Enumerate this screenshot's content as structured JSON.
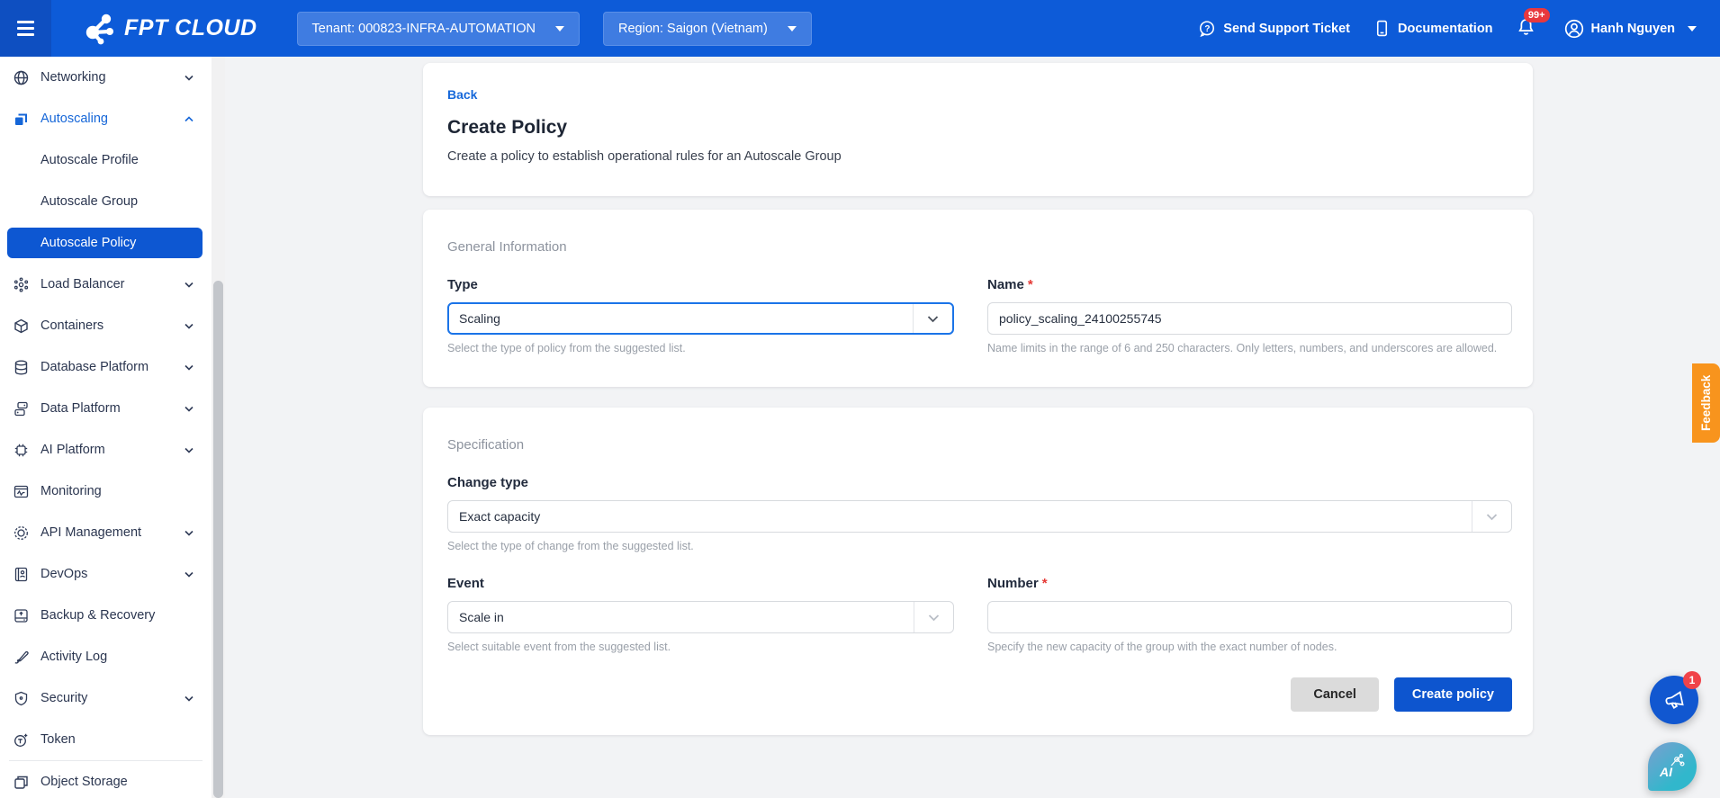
{
  "navbar": {
    "logo_text": "FPT CLOUD",
    "tenant": "Tenant: 000823-INFRA-AUTOMATION",
    "region": "Region: Saigon (Vietnam)",
    "support": "Send Support Ticket",
    "documentation": "Documentation",
    "notification_count": "99+",
    "user_name": "Hanh Nguyen"
  },
  "icons": {
    "question_glyph": "?",
    "ai_glyph": "AI"
  },
  "sidebar": {
    "items": [
      {
        "label": "Networking",
        "chevron": "down"
      },
      {
        "label": "Autoscaling",
        "chevron": "up"
      },
      {
        "label": "Load Balancer",
        "chevron": "down"
      },
      {
        "label": "Containers",
        "chevron": "down"
      },
      {
        "label": "Database Platform",
        "chevron": "down"
      },
      {
        "label": "Data Platform",
        "chevron": "down"
      },
      {
        "label": "AI Platform",
        "chevron": "down"
      },
      {
        "label": "Monitoring",
        "chevron": "none"
      },
      {
        "label": "API Management",
        "chevron": "down"
      },
      {
        "label": "DevOps",
        "chevron": "down"
      },
      {
        "label": "Backup & Recovery",
        "chevron": "none"
      },
      {
        "label": "Activity Log",
        "chevron": "none"
      },
      {
        "label": "Security",
        "chevron": "down"
      },
      {
        "label": "Token",
        "chevron": "none"
      },
      {
        "label": "Object Storage",
        "chevron": "none"
      }
    ],
    "autoscaling_children": [
      "Autoscale Profile",
      "Autoscale Group",
      "Autoscale Policy"
    ],
    "selected": "Autoscale Policy"
  },
  "page": {
    "back_label": "Back",
    "title": "Create Policy",
    "subtitle": "Create a policy to establish operational rules for an Autoscale Group"
  },
  "general": {
    "section_title": "General Information",
    "type_label": "Type",
    "type_value": "Scaling",
    "type_help": "Select the type of policy from the suggested list.",
    "name_label": "Name",
    "required_marker": "*",
    "name_value": "policy_scaling_24100255745",
    "name_help": "Name limits in the range of 6 and 250 characters. Only letters, numbers, and underscores are allowed."
  },
  "specification": {
    "section_title": "Specification",
    "change_type_label": "Change type",
    "change_type_value": "Exact capacity",
    "change_type_help": "Select the type of change from the suggested list.",
    "event_label": "Event",
    "event_value": "Scale in",
    "event_help": "Select suitable event from the suggested list.",
    "number_label": "Number",
    "number_help": "Specify the new capacity of the group with the exact number of nodes.",
    "cancel_label": "Cancel",
    "submit_label": "Create policy"
  },
  "feedback_tab": "Feedback",
  "floating": {
    "announcement_badge": "1"
  }
}
